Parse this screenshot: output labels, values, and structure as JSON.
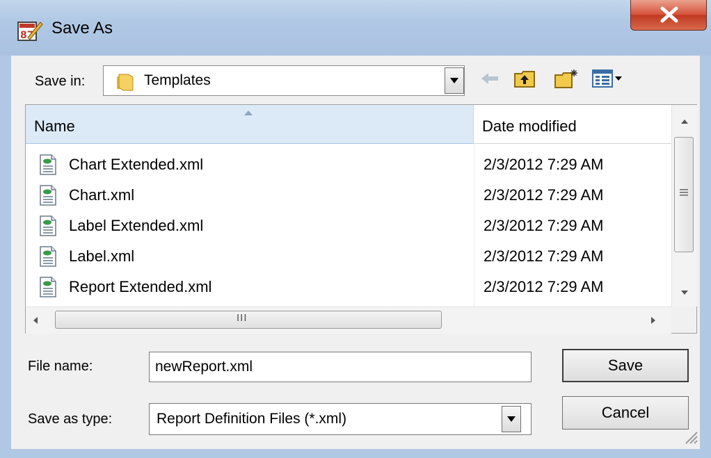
{
  "window": {
    "title": "Save As"
  },
  "save_in": {
    "label": "Save in:",
    "value": "Templates"
  },
  "columns": {
    "name": "Name",
    "date_modified": "Date modified"
  },
  "files": [
    {
      "name": "Chart Extended.xml",
      "date": "2/3/2012 7:29 AM"
    },
    {
      "name": "Chart.xml",
      "date": "2/3/2012 7:29 AM"
    },
    {
      "name": "Label Extended.xml",
      "date": "2/3/2012 7:29 AM"
    },
    {
      "name": "Label.xml",
      "date": "2/3/2012 7:29 AM"
    },
    {
      "name": "Report Extended.xml",
      "date": "2/3/2012 7:29 AM"
    }
  ],
  "hscroll_grip": "III",
  "file_name": {
    "label": "File name:",
    "value": "newReport.xml"
  },
  "save_as_type": {
    "label": "Save as type:",
    "value": "Report Definition Files (*.xml)"
  },
  "buttons": {
    "save": "Save",
    "cancel": "Cancel"
  },
  "icons": {
    "app": "report-edit-icon",
    "close": "close-icon",
    "folder": "folder-icon",
    "back": "back-arrow-icon",
    "up": "up-folder-icon",
    "new_folder": "new-folder-icon",
    "views": "views-menu-icon",
    "file": "xml-file-icon"
  },
  "colors": {
    "titlebar": "#b0c8e4",
    "close": "#c9472e",
    "header_selected": "#dceaf7"
  }
}
